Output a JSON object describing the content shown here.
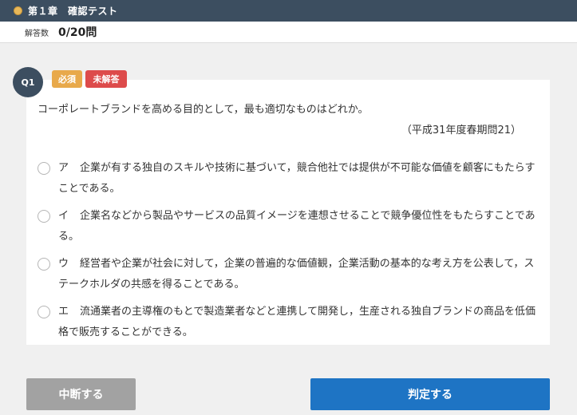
{
  "header": {
    "title": "第１章　確認テスト",
    "coin_icon": "coin-icon"
  },
  "status": {
    "answered_label": "解答数",
    "answered_count": "0/20問"
  },
  "question": {
    "number": "Q1",
    "tags": {
      "required": "必須",
      "unanswered": "未解答"
    },
    "text": "コーポレートブランドを高める目的として，最も適切なものはどれか。",
    "source": "（平成31年度春期問21）",
    "options": [
      {
        "key": "ア",
        "text": "企業が有する独自のスキルや技術に基づいて，競合他社では提供が不可能な価値を顧客にもたらすことである。"
      },
      {
        "key": "イ",
        "text": "企業名などから製品やサービスの品質イメージを連想させることで競争優位性をもたらすことである。"
      },
      {
        "key": "ウ",
        "text": "経営者や企業が社会に対して，企業の普遍的な価値観，企業活動の基本的な考え方を公表して，ステークホルダの共感を得ることである。"
      },
      {
        "key": "エ",
        "text": "流通業者の主導権のもとで製造業者などと連携して開発し，生産される独自ブランドの商品を低価格で販売することができる。"
      }
    ]
  },
  "actions": {
    "suspend_label": "中断する",
    "judge_label": "判定する"
  },
  "colors": {
    "header_bg": "#3c4e60",
    "required": "#e8a94b",
    "unanswered": "#dd4b4b",
    "primary": "#1e74c4",
    "secondary": "#a2a2a2"
  }
}
